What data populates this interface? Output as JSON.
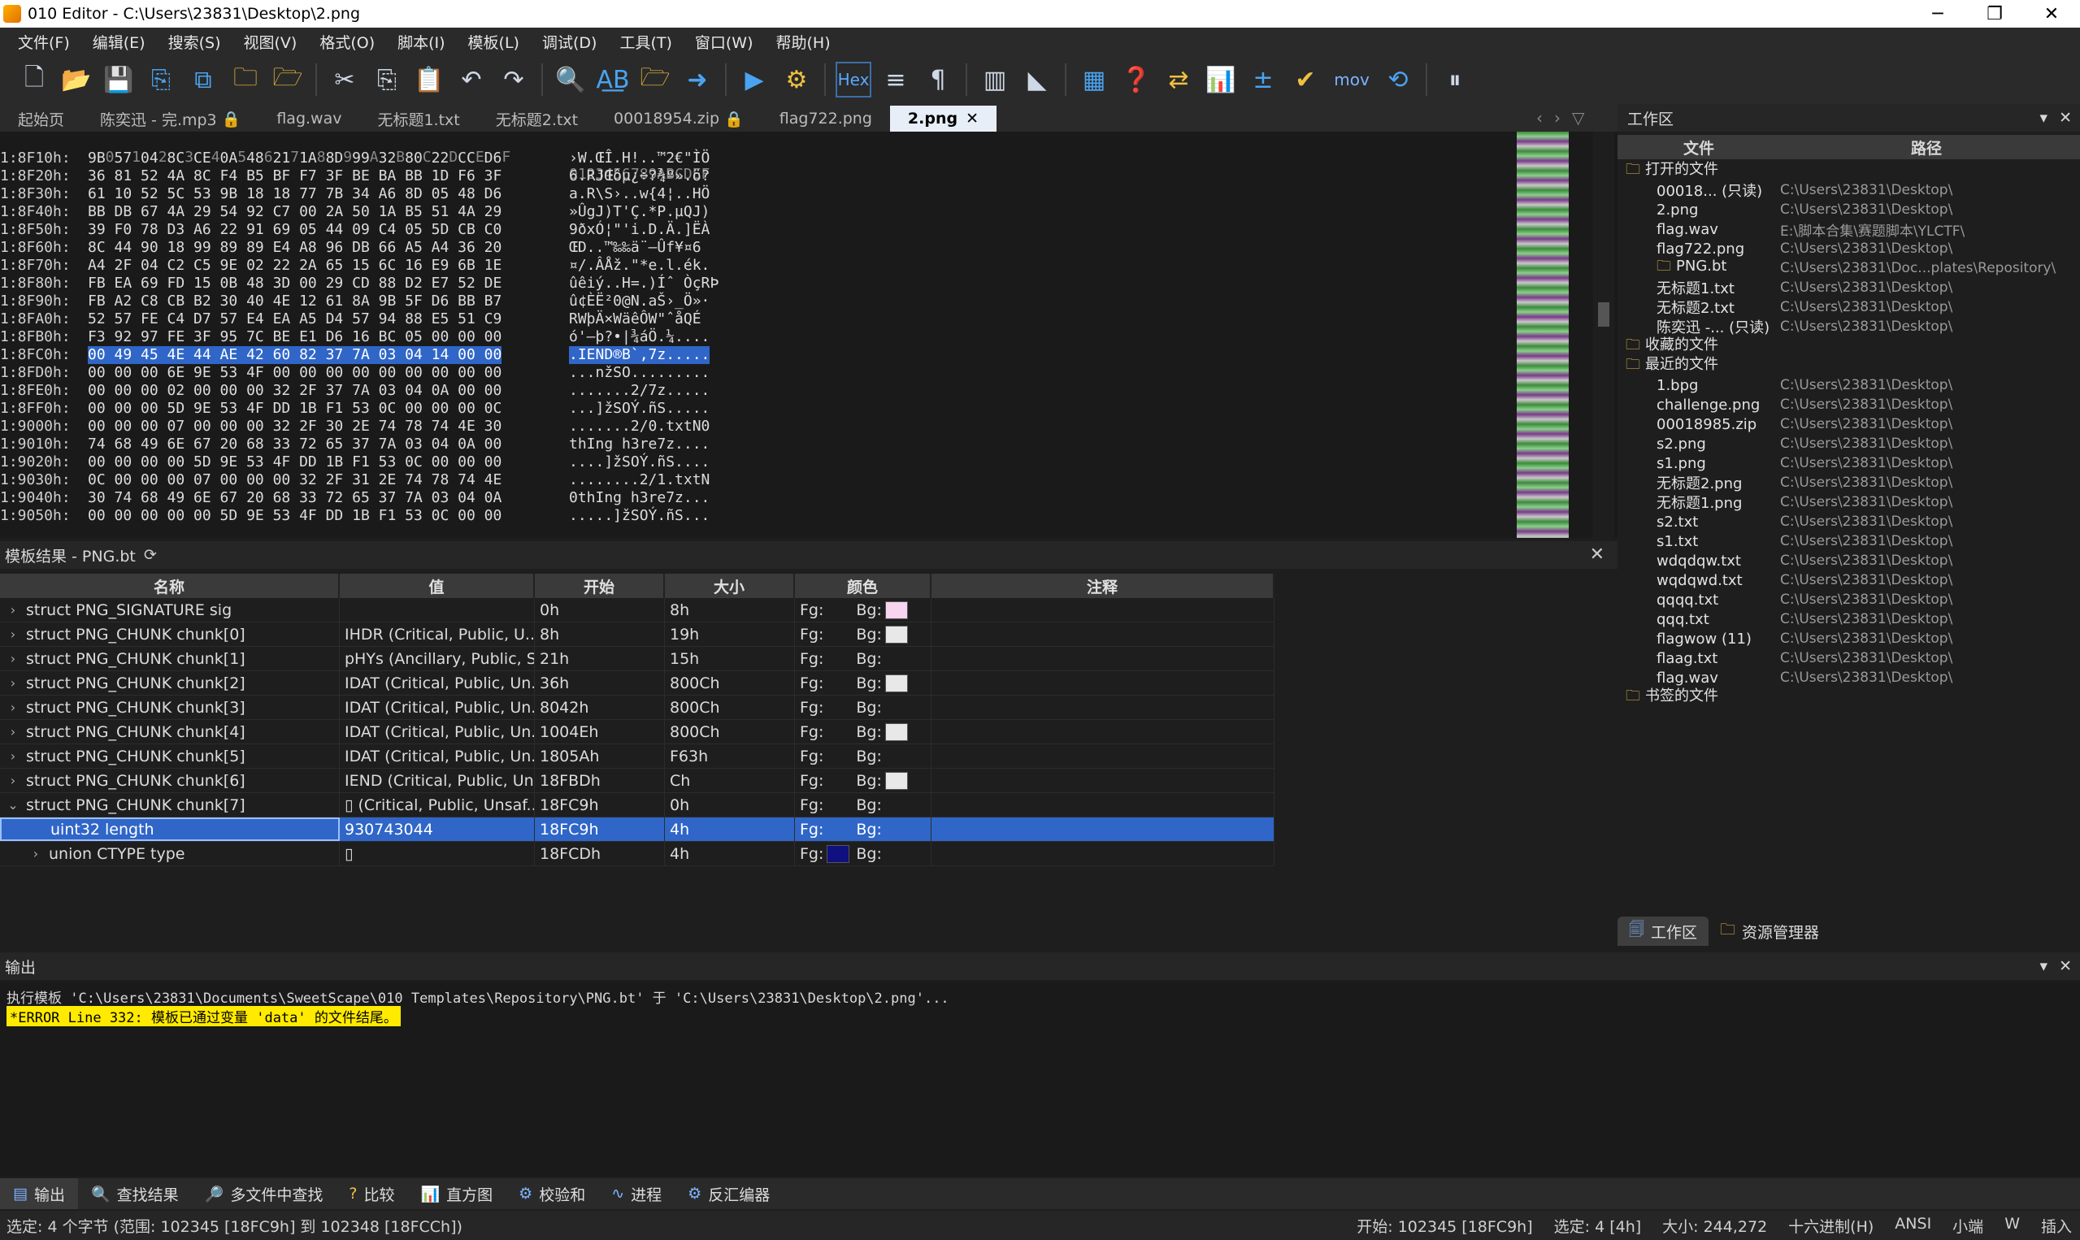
{
  "window": {
    "title": "010 Editor - C:\\Users\\23831\\Desktop\\2.png",
    "minimize": "─",
    "maximize": "❐",
    "close": "✕"
  },
  "menu": [
    "文件(F)",
    "编辑(E)",
    "搜索(S)",
    "视图(V)",
    "格式(O)",
    "脚本(I)",
    "模板(L)",
    "调试(D)",
    "工具(T)",
    "窗口(W)",
    "帮助(H)"
  ],
  "toolbar": {
    "hex_label": "Hex",
    "mov_label": "mov"
  },
  "tabs": [
    {
      "label": "起始页",
      "locked": false,
      "active": false
    },
    {
      "label": "陈奕迅 - 完.mp3",
      "locked": true,
      "active": false
    },
    {
      "label": "flag.wav",
      "locked": false,
      "active": false
    },
    {
      "label": "无标题1.txt",
      "locked": false,
      "active": false
    },
    {
      "label": "无标题2.txt",
      "locked": false,
      "active": false
    },
    {
      "label": "00018954.zip",
      "locked": true,
      "active": false
    },
    {
      "label": "flag722.png",
      "locked": false,
      "active": false
    },
    {
      "label": "2.png",
      "locked": false,
      "active": true
    }
  ],
  "hex": {
    "header_cols": "  0  1  2  3  4  5  6  7  8  9  A  B  C  D  E  F",
    "header_ascii": "0123456789ABCDEF",
    "rows": [
      {
        "addr": "1:8F10h:",
        "bytes": "9B 57 04 8C CE 0A 48 21 1A 8D 99 32 80 22 CC D6",
        "ascii": "›W.ŒÎ.H!..™2€\"ÌÖ"
      },
      {
        "addr": "1:8F20h:",
        "bytes": "36 81 52 4A 8C F4 B5 BF F7 3F BE BA BB 1D F6 3F",
        "ascii": "6.RJŒôµ¿÷?¾º».ö?"
      },
      {
        "addr": "1:8F30h:",
        "bytes": "61 10 52 5C 53 9B 18 18 77 7B 34 A6 8D 05 48 D6",
        "ascii": "a.R\\S›..w{4¦..HÖ"
      },
      {
        "addr": "1:8F40h:",
        "bytes": "BB DB 67 4A 29 54 92 C7 00 2A 50 1A B5 51 4A 29",
        "ascii": "»ÛgJ)T'Ç.*P.µQJ)"
      },
      {
        "addr": "1:8F50h:",
        "bytes": "39 F0 78 D3 A6 22 91 69 05 44 09 C4 05 5D CB C0",
        "ascii": "9ðxÓ¦\"'i.D.Ä.]ËÀ"
      },
      {
        "addr": "1:8F60h:",
        "bytes": "8C 44 90 18 99 89 89 E4 A8 96 DB 66 A5 A4 36 20",
        "ascii": "ŒD..™‰‰ä¨–Ûf¥¤6 "
      },
      {
        "addr": "1:8F70h:",
        "bytes": "A4 2F 04 C2 C5 9E 02 22 2A 65 15 6C 16 E9 6B 1E",
        "ascii": "¤/.ÂÅž.\"*e.l.ék."
      },
      {
        "addr": "1:8F80h:",
        "bytes": "FB EA 69 FD 15 0B 48 3D 00 29 CD 88 D2 E7 52 DE",
        "ascii": "ûêiý..H=.)Íˆ ÒçRÞ"
      },
      {
        "addr": "1:8F90h:",
        "bytes": "FB A2 C8 CB B2 30 40 4E 12 61 8A 9B 5F D6 BB B7",
        "ascii": "û¢ÈË²0@N.aŠ›_Ö»·"
      },
      {
        "addr": "1:8FA0h:",
        "bytes": "52 57 FE C4 D7 57 E4 EA A5 D4 57 94 88 E5 51 C9",
        "ascii": "RWþÄ×WäêÔW\"ˆåQÉ"
      },
      {
        "addr": "1:8FB0h:",
        "bytes": "F3 92 97 FE 3F 95 7C BE E1 D6 16 BC 05 00 00 00",
        "ascii": "ó'—þ?•|¾áÖ.¼...."
      },
      {
        "addr": "1:8FC0h:",
        "bytes": "00 49 45 4E 44 AE 42 60 82 37 7A 03 04 14 00 00",
        "ascii": ".IEND®B`‚7z....."
      },
      {
        "addr": "1:8FD0h:",
        "bytes": "00 00 00 6E 9E 53 4F 00 00 00 00 00 00 00 00 00",
        "ascii": "...nžSO........."
      },
      {
        "addr": "1:8FE0h:",
        "bytes": "00 00 00 02 00 00 00 32 2F 37 7A 03 04 0A 00 00",
        "ascii": ".......2/7z....."
      },
      {
        "addr": "1:8FF0h:",
        "bytes": "00 00 00 5D 9E 53 4F DD 1B F1 53 0C 00 00 00 0C",
        "ascii": "...]žSOÝ.ñS....."
      },
      {
        "addr": "1:9000h:",
        "bytes": "00 00 00 07 00 00 00 32 2F 30 2E 74 78 74 4E 30",
        "ascii": ".......2/0.txtN0"
      },
      {
        "addr": "1:9010h:",
        "bytes": "74 68 49 6E 67 20 68 33 72 65 37 7A 03 04 0A 00",
        "ascii": "thIng h3re7z...."
      },
      {
        "addr": "1:9020h:",
        "bytes": "00 00 00 00 5D 9E 53 4F DD 1B F1 53 0C 00 00 00",
        "ascii": "....]žSOÝ.ñS...."
      },
      {
        "addr": "1:9030h:",
        "bytes": "0C 00 00 00 07 00 00 00 32 2F 31 2E 74 78 74 4E",
        "ascii": "........2/1.txtN"
      },
      {
        "addr": "1:9040h:",
        "bytes": "30 74 68 49 6E 67 20 68 33 72 65 37 7A 03 04 0A",
        "ascii": "0thIng h3re7z..."
      },
      {
        "addr": "1:9050h:",
        "bytes": "00 00 00 00 00 5D 9E 53 4F DD 1B F1 53 0C 00 00",
        "ascii": ".....]žSOÝ.ñS..."
      }
    ]
  },
  "template": {
    "title": "模板结果 - PNG.bt",
    "refresh_icon": "refresh-icon",
    "close": "✕",
    "columns": [
      "名称",
      "值",
      "开始",
      "大小",
      "颜色",
      "注释"
    ],
    "rows": [
      {
        "name": "struct PNG_SIGNATURE sig",
        "value": "",
        "start": "0h",
        "size": "8h",
        "fg": "Fg:",
        "bg": "Bg:",
        "bg_color": "#f7d4f0",
        "fg_color": "",
        "expander": "›",
        "indent": 0
      },
      {
        "name": "struct PNG_CHUNK chunk[0]",
        "value": "IHDR  (Critical, Public, U...",
        "start": "8h",
        "size": "19h",
        "fg": "Fg:",
        "bg": "Bg:",
        "bg_color": "#e8e8e8",
        "fg_color": "",
        "expander": "›",
        "indent": 0
      },
      {
        "name": "struct PNG_CHUNK chunk[1]",
        "value": "pHYs  (Ancillary, Public, S...",
        "start": "21h",
        "size": "15h",
        "fg": "Fg:",
        "bg": "Bg:",
        "bg_color": "",
        "fg_color": "",
        "expander": "›",
        "indent": 0
      },
      {
        "name": "struct PNG_CHUNK chunk[2]",
        "value": "IDAT  (Critical, Public, Un...",
        "start": "36h",
        "size": "800Ch",
        "fg": "Fg:",
        "bg": "Bg:",
        "bg_color": "#e8e8e8",
        "fg_color": "",
        "expander": "›",
        "indent": 0
      },
      {
        "name": "struct PNG_CHUNK chunk[3]",
        "value": "IDAT  (Critical, Public, Un...",
        "start": "8042h",
        "size": "800Ch",
        "fg": "Fg:",
        "bg": "Bg:",
        "bg_color": "",
        "fg_color": "",
        "expander": "›",
        "indent": 0
      },
      {
        "name": "struct PNG_CHUNK chunk[4]",
        "value": "IDAT  (Critical, Public, Un...",
        "start": "1004Eh",
        "size": "800Ch",
        "fg": "Fg:",
        "bg": "Bg:",
        "bg_color": "#e8e8e8",
        "fg_color": "",
        "expander": "›",
        "indent": 0
      },
      {
        "name": "struct PNG_CHUNK chunk[5]",
        "value": "IDAT  (Critical, Public, Un...",
        "start": "1805Ah",
        "size": "F63h",
        "fg": "Fg:",
        "bg": "Bg:",
        "bg_color": "",
        "fg_color": "",
        "expander": "›",
        "indent": 0
      },
      {
        "name": "struct PNG_CHUNK chunk[6]",
        "value": "IEND  (Critical, Public, Un...",
        "start": "18FBDh",
        "size": "Ch",
        "fg": "Fg:",
        "bg": "Bg:",
        "bg_color": "#e8e8e8",
        "fg_color": "",
        "expander": "›",
        "indent": 0
      },
      {
        "name": "struct PNG_CHUNK chunk[7]",
        "value": "▯  (Critical, Public, Unsaf...",
        "start": "18FC9h",
        "size": "0h",
        "fg": "Fg:",
        "bg": "Bg:",
        "bg_color": "",
        "fg_color": "",
        "expander": "⌄",
        "indent": 0
      },
      {
        "name": "uint32 length",
        "value": "930743044",
        "start": "18FC9h",
        "size": "4h",
        "fg": "Fg:",
        "bg": "Bg:",
        "bg_color": "",
        "fg_color": "",
        "expander": "",
        "indent": 1,
        "selected": true
      },
      {
        "name": "union CTYPE type",
        "value": "▯",
        "start": "18FCDh",
        "size": "4h",
        "fg": "Fg:",
        "bg": "Bg:",
        "bg_color": "",
        "fg_color": "#101080",
        "expander": "›",
        "indent": 1
      }
    ]
  },
  "workspace": {
    "title": "工作区",
    "columns": [
      "文件",
      "路径"
    ],
    "items": [
      {
        "name": "打开的文件",
        "path": "",
        "folder": true,
        "indent": 0
      },
      {
        "name": "00018... (只读)",
        "path": "C:\\Users\\23831\\Desktop\\",
        "indent": 1
      },
      {
        "name": "2.png",
        "path": "C:\\Users\\23831\\Desktop\\",
        "indent": 1
      },
      {
        "name": "flag.wav",
        "path": "E:\\脚本合集\\赛题脚本\\YLCTF\\",
        "indent": 1
      },
      {
        "name": "flag722.png",
        "path": "C:\\Users\\23831\\Desktop\\",
        "indent": 1
      },
      {
        "name": "PNG.bt",
        "path": "C:\\Users\\23831\\Doc...plates\\Repository\\",
        "indent": 1,
        "folder": true
      },
      {
        "name": "无标题1.txt",
        "path": "C:\\Users\\23831\\Desktop\\",
        "indent": 1
      },
      {
        "name": "无标题2.txt",
        "path": "C:\\Users\\23831\\Desktop\\",
        "indent": 1
      },
      {
        "name": "陈奕迅 -... (只读)",
        "path": "C:\\Users\\23831\\Desktop\\",
        "indent": 1
      },
      {
        "name": "收藏的文件",
        "path": "",
        "folder": true,
        "indent": 0
      },
      {
        "name": "最近的文件",
        "path": "",
        "folder": true,
        "indent": 0
      },
      {
        "name": "1.bpg",
        "path": "C:\\Users\\23831\\Desktop\\",
        "indent": 1
      },
      {
        "name": "challenge.png",
        "path": "C:\\Users\\23831\\Desktop\\",
        "indent": 1
      },
      {
        "name": "00018985.zip",
        "path": "C:\\Users\\23831\\Desktop\\",
        "indent": 1
      },
      {
        "name": "s2.png",
        "path": "C:\\Users\\23831\\Desktop\\",
        "indent": 1
      },
      {
        "name": "s1.png",
        "path": "C:\\Users\\23831\\Desktop\\",
        "indent": 1
      },
      {
        "name": "无标题2.png",
        "path": "C:\\Users\\23831\\Desktop\\",
        "indent": 1
      },
      {
        "name": "无标题1.png",
        "path": "C:\\Users\\23831\\Desktop\\",
        "indent": 1
      },
      {
        "name": "s2.txt",
        "path": "C:\\Users\\23831\\Desktop\\",
        "indent": 1
      },
      {
        "name": "s1.txt",
        "path": "C:\\Users\\23831\\Desktop\\",
        "indent": 1
      },
      {
        "name": "wdqdqw.txt",
        "path": "C:\\Users\\23831\\Desktop\\",
        "indent": 1
      },
      {
        "name": "wqdqwd.txt",
        "path": "C:\\Users\\23831\\Desktop\\",
        "indent": 1
      },
      {
        "name": "qqqq.txt",
        "path": "C:\\Users\\23831\\Desktop\\",
        "indent": 1
      },
      {
        "name": "qqq.txt",
        "path": "C:\\Users\\23831\\Desktop\\",
        "indent": 1
      },
      {
        "name": "flagwow (11)",
        "path": "C:\\Users\\23831\\Desktop\\",
        "indent": 1
      },
      {
        "name": "flaag.txt",
        "path": "C:\\Users\\23831\\Desktop\\",
        "indent": 1
      },
      {
        "name": "flag.wav",
        "path": "C:\\Users\\23831\\Desktop\\",
        "indent": 1
      },
      {
        "name": "书签的文件",
        "path": "",
        "folder": true,
        "indent": 0
      }
    ],
    "tabs": [
      "工作区",
      "资源管理器"
    ]
  },
  "output": {
    "title": "输出",
    "line1": "执行模板 'C:\\Users\\23831\\Documents\\SweetScape\\010 Templates\\Repository\\PNG.bt' 于 'C:\\Users\\23831\\Desktop\\2.png'...",
    "error": "*ERROR Line 332: 模板已通过变量 'data' 的文件结尾。"
  },
  "bottom_tabs": [
    "输出",
    "查找结果",
    "多文件中查找",
    "比较",
    "直方图",
    "校验和",
    "进程",
    "反汇编器"
  ],
  "status": {
    "left": "选定: 4 个字节 (范围: 102345 [18FC9h] 到 102348 [18FCCh])",
    "start": "开始: 102345 [18FC9h]",
    "sel": "选定: 4 [4h]",
    "size": "大小: 244,272",
    "mode": "十六进制(H)",
    "enc": "ANSI",
    "endian": "小端",
    "w": "W",
    "ins": "插入"
  }
}
